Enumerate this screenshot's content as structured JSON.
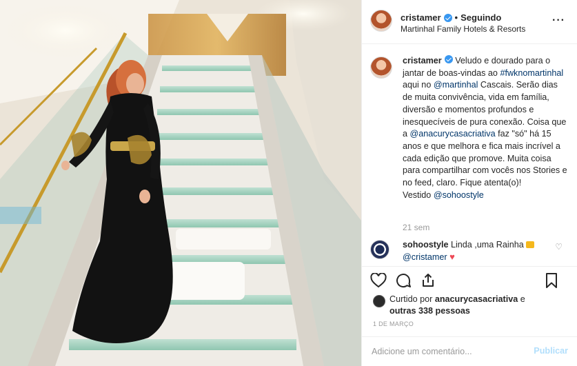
{
  "header": {
    "username": "cristamer",
    "separator": "•",
    "follow_status": "Seguindo",
    "location": "Martinhal Family Hotels & Resorts",
    "more_icon": "more-options-icon"
  },
  "caption": {
    "username": "cristamer",
    "part1": "Veludo e dourado para o jantar de boas-vindas ao",
    "hashtag": "#fwknomartinhal",
    "part2": "aqui no",
    "mention1": "@martinhal",
    "part3": "Cascais. Serão dias de muita convivência, vida em família, diversão e momentos profundos e inesquecíveis de pura conexão. Coisa que a",
    "mention2": "@anacurycasacriativa",
    "part4": "faz \"só\" há 15 anos e que melhora e fica mais incrível a cada edição que promove. Muita coisa para compartilhar com vocês nos Stories e no feed, claro. Fique atenta(o)!",
    "part5": "Vestido",
    "mention3": "@sohoostyle",
    "time_ago": "21 sem"
  },
  "comment": {
    "username": "sohoostyle",
    "text": "Linda ,uma Rainha",
    "mention": "@cristamer",
    "heart": "♥",
    "like_icon": "♡"
  },
  "actions": [
    "like-icon",
    "comment-icon",
    "share-icon",
    "save-icon"
  ],
  "likes": {
    "prefix": "Curtido por",
    "user": "anacurycasacriativa",
    "joiner": "e",
    "others": "outras 338 pessoas"
  },
  "date": "1 DE MARÇO",
  "add_comment": {
    "placeholder": "Adicione um comentário...",
    "post_label": "Publicar"
  },
  "colors": {
    "verified": "#3897f0",
    "link": "#003569",
    "post_button_disabled": "#b2dffc",
    "heart": "#ed4956"
  }
}
